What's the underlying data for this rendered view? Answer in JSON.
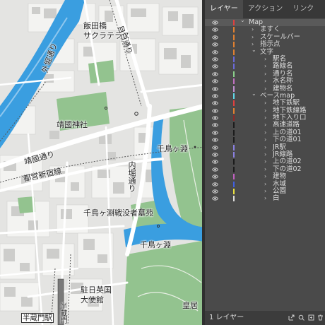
{
  "map": {
    "labels": {
      "gaibori": "外堀通り",
      "iidabashi": "飯田橋",
      "sakura_terrace": "サクラテラス",
      "meijiro": "目白通り",
      "yasukuni_shrine": "靖國神社",
      "yasukuni_dori": "靖國通り",
      "toei_shinjuku": "都営新宿線",
      "uchibori": "内堀通り",
      "chidorigafuchi": "千鳥ヶ淵",
      "chidorigafuchi_cemetery": "千鳥ヶ淵戦没者墓苑",
      "chidorigafuchi_water": "千鳥ヶ淵",
      "british_embassy_1": "駐日英国",
      "british_embassy_2": "大使館",
      "hanzomon_station": "半蔵門駅",
      "hanzomon_line": "半蔵門",
      "kokyo": "皇居"
    },
    "colors": {
      "background": "#e4e4e2",
      "block": "#f5f5f4",
      "building": "#cfcfcd",
      "park": "#8fc28c",
      "water": "#3b9fe0",
      "road": "#ffffff"
    }
  },
  "panel": {
    "tabs": [
      {
        "label": "レイヤー",
        "active": true
      },
      {
        "label": "アクション",
        "active": false
      },
      {
        "label": "リンク",
        "active": false
      }
    ],
    "menu_icon": "panel-menu-icon",
    "layers": [
      {
        "name": "Map",
        "level": 0,
        "color": "#e04040",
        "expanded": true,
        "selected": true
      },
      {
        "name": "ますく",
        "level": 1,
        "color": "#e08030",
        "expanded": false
      },
      {
        "name": "スケールバー",
        "level": 1,
        "color": "#e08030",
        "expanded": false
      },
      {
        "name": "指示点",
        "level": 1,
        "color": "#e08030",
        "expanded": false
      },
      {
        "name": "文字",
        "level": 1,
        "color": "#e08030",
        "expanded": true
      },
      {
        "name": "駅名",
        "level": 2,
        "color": "#6a6ad8",
        "expanded": false
      },
      {
        "name": "路線名",
        "level": 2,
        "color": "#6a6ad8",
        "expanded": false
      },
      {
        "name": "通り名",
        "level": 2,
        "color": "#8ccf8c",
        "expanded": false
      },
      {
        "name": "水名称",
        "level": 2,
        "color": "#c070c0",
        "expanded": false
      },
      {
        "name": "建物名",
        "level": 2,
        "color": "#c090d0",
        "expanded": false
      },
      {
        "name": "ベースmap",
        "level": 1,
        "color": "#60d8e8",
        "expanded": true
      },
      {
        "name": "地下鉄駅",
        "level": 2,
        "color": "#e04040",
        "expanded": false
      },
      {
        "name": "地下鉄線路",
        "level": 2,
        "color": "#e08030",
        "expanded": false
      },
      {
        "name": "地下入り口",
        "level": 2,
        "color": "#8a2a2a",
        "expanded": false
      },
      {
        "name": "高速道路",
        "level": 2,
        "color": "#1c1c1c",
        "expanded": false
      },
      {
        "name": "上の道01",
        "level": 2,
        "color": "#1c1c1c",
        "expanded": false
      },
      {
        "name": "下の道01",
        "level": 2,
        "color": "#1c1c1c",
        "expanded": false
      },
      {
        "name": "JR駅",
        "level": 2,
        "color": "#8a80e0",
        "expanded": false
      },
      {
        "name": "JR線路",
        "level": 2,
        "color": "#8a80e0",
        "expanded": false
      },
      {
        "name": "上の道02",
        "level": 2,
        "color": "#1c1c1c",
        "expanded": false
      },
      {
        "name": "下の道02",
        "level": 2,
        "color": "#1c1c1c",
        "expanded": false
      },
      {
        "name": "建物",
        "level": 2,
        "color": "#c060c0",
        "expanded": false
      },
      {
        "name": "水域",
        "level": 2,
        "color": "#4060e0",
        "expanded": false
      },
      {
        "name": "公園",
        "level": 2,
        "color": "#e8e040",
        "expanded": false
      },
      {
        "name": "白",
        "level": 2,
        "color": "#dddddd",
        "expanded": false
      }
    ],
    "footer": {
      "count_label": "1 レイヤー"
    }
  }
}
